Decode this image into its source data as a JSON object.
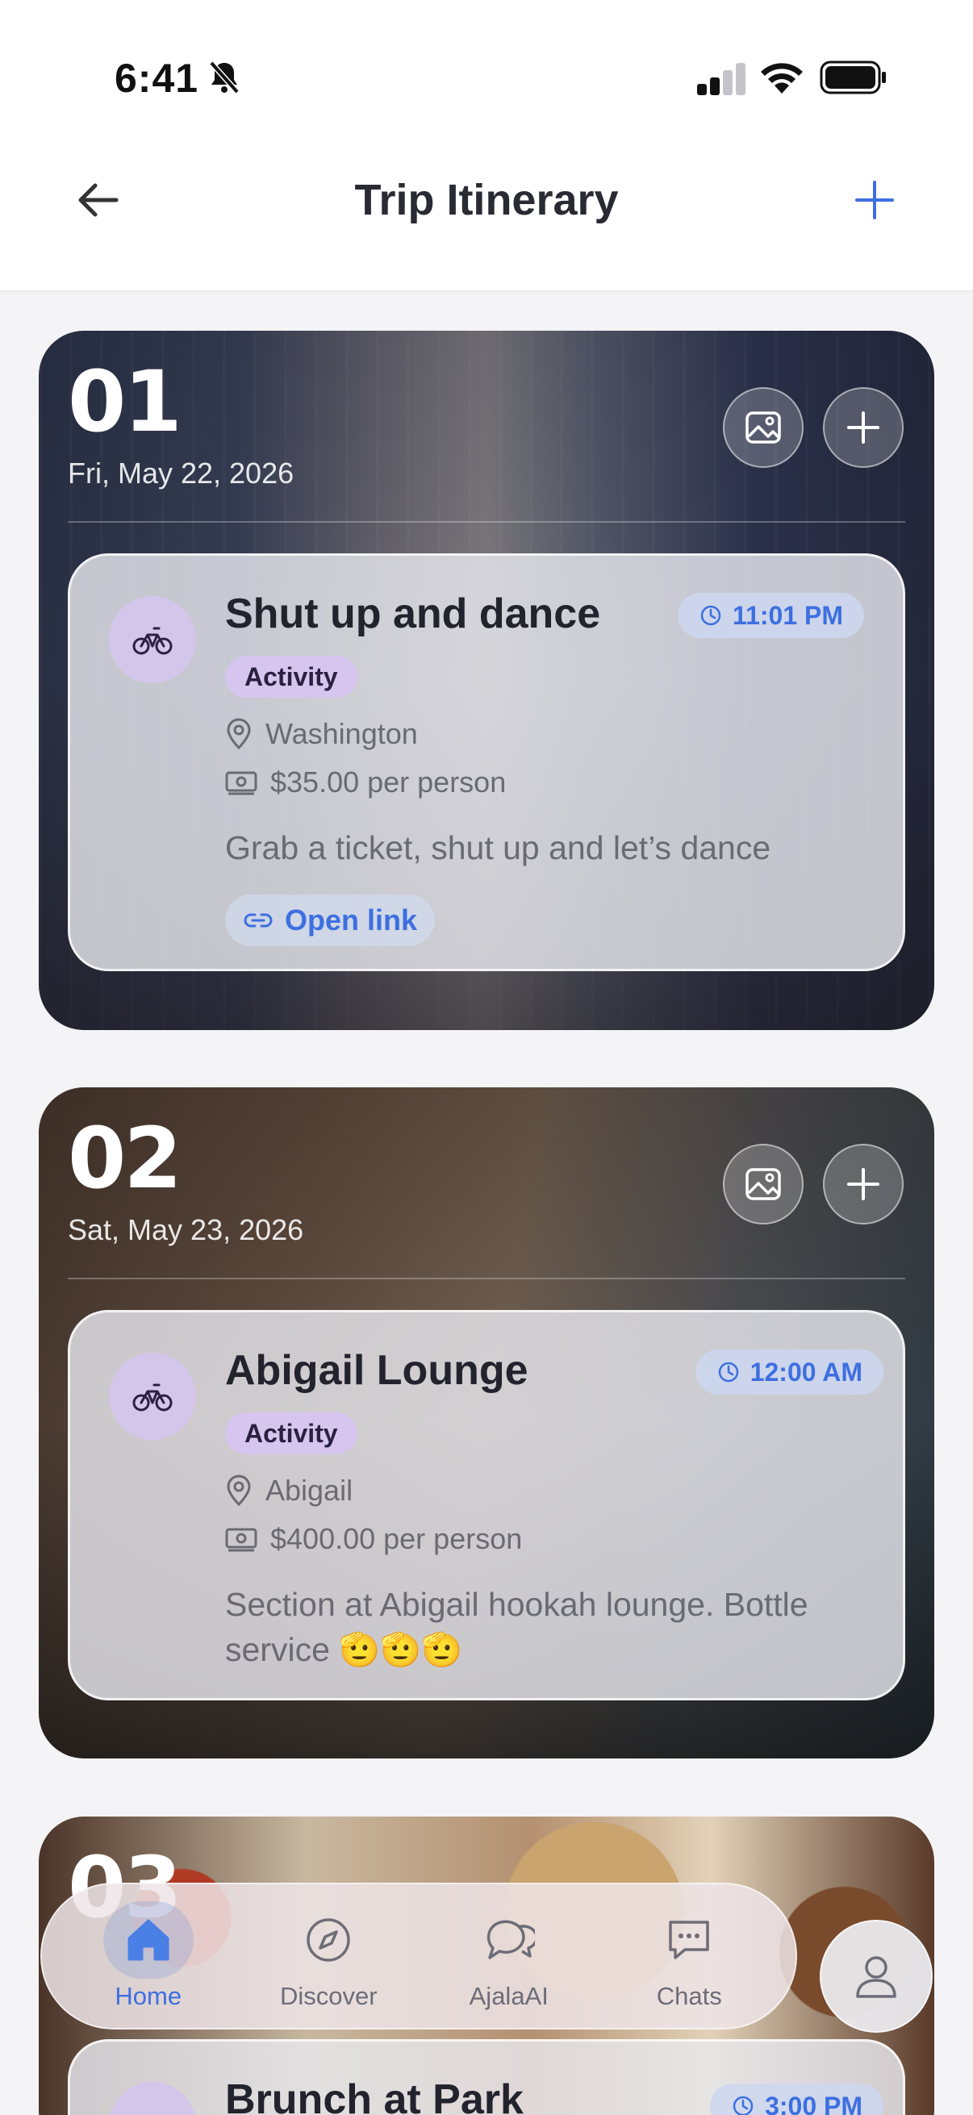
{
  "status_bar": {
    "time": "6:41"
  },
  "header": {
    "title": "Trip Itinerary"
  },
  "days": [
    {
      "number": "01",
      "date": "Fri, May 22, 2026",
      "activity": {
        "title": "Shut up and dance",
        "time": "11:01 PM",
        "type": "Activity",
        "location": "Washington",
        "cost": "$35.00 per person",
        "description": "Grab a ticket, shut up and let’s dance",
        "link_label": "Open link"
      }
    },
    {
      "number": "02",
      "date": "Sat, May 23, 2026",
      "activity": {
        "title": "Abigail Lounge",
        "time": "12:00 AM",
        "type": "Activity",
        "location": "Abigail",
        "cost": "$400.00 per person",
        "description": "Section at Abigail hookah lounge. Bottle service 🫡🫡🫡"
      }
    },
    {
      "number": "03",
      "activity": {
        "title": "Brunch at Park",
        "time": "3:00 PM"
      }
    }
  ],
  "nav": {
    "items": [
      {
        "label": "Home",
        "icon": "home-icon",
        "active": true
      },
      {
        "label": "Discover",
        "icon": "compass-icon",
        "active": false
      },
      {
        "label": "AjalaAI",
        "icon": "chat-bubbles-icon",
        "active": false
      },
      {
        "label": "Chats",
        "icon": "message-icon",
        "active": false
      }
    ]
  },
  "colors": {
    "accent": "#3d6fe0",
    "tag_bg": "#d6c6ef",
    "icon_bg": "#d4c6ea"
  }
}
